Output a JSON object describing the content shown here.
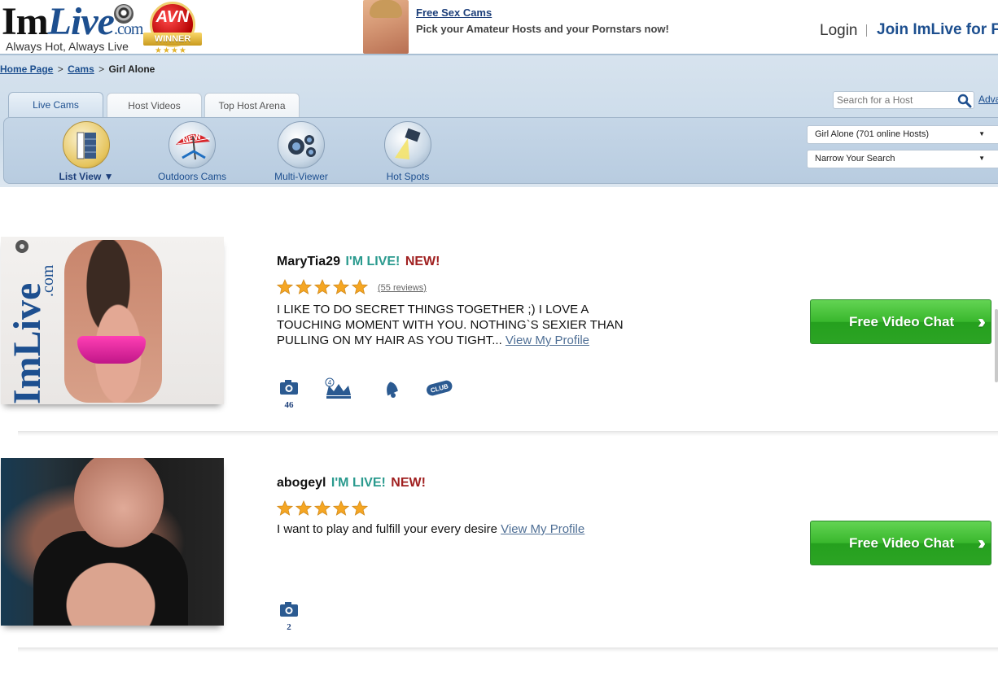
{
  "header": {
    "logo": {
      "brand_im": "Im",
      "brand_live": "Live",
      "brand_com": ".com",
      "tagline": "Always Hot, Always Live"
    },
    "award": {
      "title": "AVN",
      "ribbon": "WINNER"
    },
    "promo": {
      "link": "Free Sex Cams",
      "subtitle": "Pick your Amateur Hosts and your Pornstars now!"
    },
    "login": "Login",
    "join": "Join ImLive for FREE"
  },
  "breadcrumb": {
    "home": "Home Page",
    "cams": "Cams",
    "current": "Girl Alone",
    "separator": ">"
  },
  "tabs": [
    {
      "label": "Live Cams",
      "active": true
    },
    {
      "label": "Host Videos",
      "active": false
    },
    {
      "label": "Top Host Arena",
      "active": false
    }
  ],
  "search": {
    "placeholder": "Search for a Host",
    "advanced": "Advanced"
  },
  "tools": [
    {
      "label": "List View ▼",
      "icon": "list-view-icon"
    },
    {
      "label": "Outdoors Cams",
      "icon": "outdoors-icon"
    },
    {
      "label": "Multi-Viewer",
      "icon": "multi-viewer-icon"
    },
    {
      "label": "Hot Spots",
      "icon": "hot-spots-icon"
    }
  ],
  "filters": {
    "category": "Girl Alone  (701 online Hosts)",
    "narrow": "Narrow Your Search"
  },
  "hosts": [
    {
      "name": "MaryTia29",
      "live": "I'M LIVE!",
      "new": "NEW!",
      "rating": 5,
      "reviews": "(55 reviews)",
      "bio": "I LIKE TO DO SECRET THINGS TOGETHER ;) I LOVE A TOUCHING MOMENT WITH YOU. NOTHING`S SEXIER THAN PULLING ON MY HAIR AS YOU TIGHT...",
      "profile_link": "View My Profile",
      "photos": "46",
      "crown_level": "4",
      "club": "CLUB",
      "chat_button": "Free Video Chat"
    },
    {
      "name": "abogeyl",
      "live": "I'M LIVE!",
      "new": "NEW!",
      "rating": 5,
      "bio": "I want to play and fulfill your every desire",
      "profile_link": "View My Profile",
      "photos": "2",
      "chat_button": "Free Video Chat"
    }
  ],
  "colors": {
    "brand_blue": "#1d4f8f",
    "live_teal": "#2a9a8e",
    "new_red": "#a02020",
    "button_green": "#39b72d",
    "band_blue": "#cbdbea",
    "star_gold": "#f5a623"
  }
}
